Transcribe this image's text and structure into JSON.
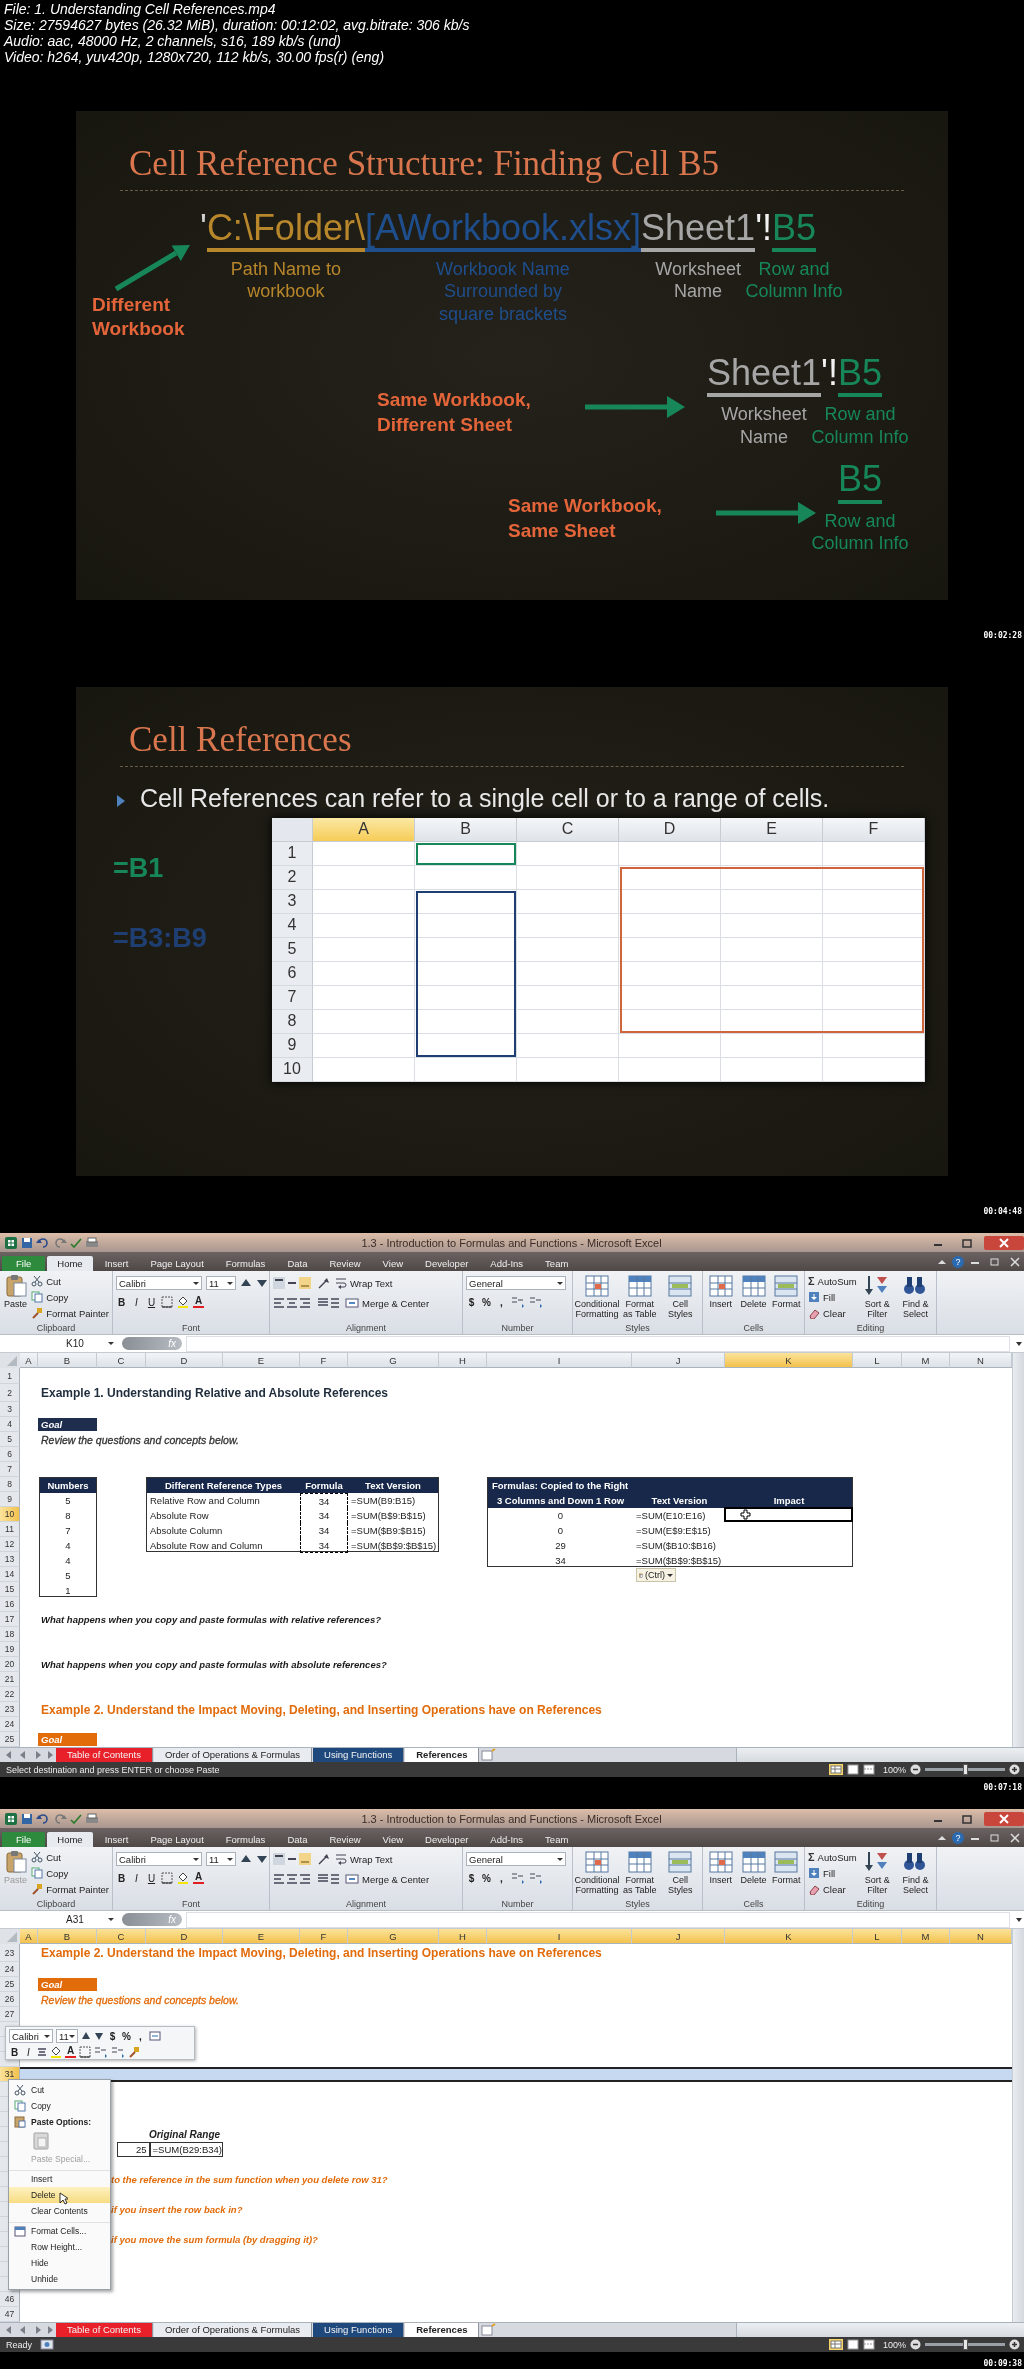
{
  "file_info": [
    "File: 1. Understanding Cell References.mp4",
    "Size: 27594627 bytes (26.32 MiB), duration: 00:12:02, avg.bitrate: 306 kb/s",
    "Audio: aac, 48000 Hz, 2 channels, s16, 189 kb/s (und)",
    "Video: h264, yuv420p, 1280x720, 112 kb/s, 30.00 fps(r) (eng)"
  ],
  "frames": [
    {
      "kind": "reference_slide",
      "timestamp": "00:02:28",
      "title": "Cell Reference Structure: Finding Cell B5",
      "examples": [
        {
          "kind": "full",
          "label": "Different Workbook",
          "segments": [
            {
              "text": "'",
              "color": "#d0d0d0"
            },
            {
              "text": "C:\\Folder\\",
              "color": "#b8862b",
              "caption": "Path Name to\nworkbook"
            },
            {
              "text": "[AWorkbook.xlsx]",
              "color": "#1f4e8c",
              "caption": "Workbook Name\nSurrounded by\nsquare brackets"
            },
            {
              "text": "Sheet1",
              "color": "#a6a6a6",
              "caption": "Worksheet\nName"
            },
            {
              "text": "'!",
              "color": "#f2f2f2"
            },
            {
              "text": "B5",
              "color": "#17875a",
              "caption": "Row and\nColumn Info"
            }
          ]
        },
        {
          "kind": "short",
          "label": "Same Workbook, Different Sheet",
          "segments": [
            {
              "text": "Sheet1",
              "color": "#a6a6a6",
              "caption": "Worksheet\nName"
            },
            {
              "text": "'!",
              "color": "#f2f2f2"
            },
            {
              "text": "B5",
              "color": "#17875a",
              "caption": "Row and\nColumn Info"
            }
          ]
        },
        {
          "kind": "short",
          "label": "Same Workbook, Same Sheet",
          "segments": [
            {
              "text": "B5",
              "color": "#17875a",
              "caption": "Row and\nColumn Info"
            }
          ]
        }
      ]
    },
    {
      "kind": "ranges_slide",
      "timestamp": "00:04:48",
      "title": "Cell References",
      "bullet": "Cell References can refer to a single cell or to a range of cells.",
      "references": [
        {
          "text": "=B1",
          "color": "#17875a"
        },
        {
          "text": "=B3:B9",
          "color": "#1f3f73"
        }
      ],
      "grid": {
        "columns": [
          {
            "label": "A",
            "selected": true
          },
          {
            "label": "B",
            "selected": false
          },
          {
            "label": "C",
            "selected": false
          },
          {
            "label": "D",
            "selected": false
          },
          {
            "label": "E",
            "selected": false
          },
          {
            "label": "F",
            "selected": false
          }
        ],
        "rows": [
          "1",
          "2",
          "3",
          "4",
          "5",
          "6",
          "7",
          "8",
          "9",
          "10"
        ],
        "selections": [
          {
            "color": "#17875a"
          },
          {
            "color": "#1f3f73"
          },
          {
            "color": "#d0643c"
          }
        ]
      }
    },
    {
      "kind": "excel",
      "timestamp": "00:07:18",
      "title": "1.3 - Introduction to Formulas and Functions - Microsoft Excel",
      "help": "?",
      "tabs": [
        {
          "label": "File",
          "kind": "file",
          "selected": false
        },
        {
          "label": "Home",
          "kind": "tab",
          "selected": true
        },
        {
          "label": "Insert",
          "kind": "tab",
          "selected": false
        },
        {
          "label": "Page Layout",
          "kind": "tab",
          "selected": false
        },
        {
          "label": "Formulas",
          "kind": "tab",
          "selected": false
        },
        {
          "label": "Data",
          "kind": "tab",
          "selected": false
        },
        {
          "label": "Review",
          "kind": "tab",
          "selected": false
        },
        {
          "label": "View",
          "kind": "tab",
          "selected": false
        },
        {
          "label": "Developer",
          "kind": "tab",
          "selected": false
        },
        {
          "label": "Add-Ins",
          "kind": "tab",
          "selected": false
        },
        {
          "label": "Team",
          "kind": "tab",
          "selected": false
        }
      ],
      "ribbon": [
        {
          "kind": "clipboard",
          "name": "Clipboard",
          "items": [
            {
              "label": "Paste",
              "disabled": false
            },
            {
              "label": "Cut",
              "disabled": false
            },
            {
              "label": "Copy",
              "disabled": false
            },
            {
              "label": "Format Painter",
              "disabled": false
            }
          ]
        },
        {
          "kind": "font",
          "name": "Font",
          "items": [
            {
              "label": "Calibri"
            },
            {
              "label": "11"
            },
            {
              "label": "B"
            },
            {
              "label": "I"
            },
            {
              "label": "U"
            },
            {
              "label": "A"
            }
          ]
        },
        {
          "kind": "alignment",
          "name": "Alignment",
          "items": [
            {
              "label": "Wrap Text"
            },
            {
              "label": "Merge & Center"
            }
          ]
        },
        {
          "kind": "number",
          "name": "Number",
          "items": [
            {
              "label": "General"
            },
            {
              "label": "$"
            },
            {
              "label": "%"
            },
            {
              "label": ","
            }
          ]
        },
        {
          "kind": "large",
          "name": "Styles",
          "items": [
            {
              "label": "Conditional Formatting"
            },
            {
              "label": "Format as Table"
            },
            {
              "label": "Cell Styles"
            }
          ]
        },
        {
          "kind": "large",
          "name": "Cells",
          "items": [
            {
              "label": "Insert"
            },
            {
              "label": "Delete"
            },
            {
              "label": "Format"
            }
          ]
        },
        {
          "kind": "editing",
          "name": "Editing",
          "items": [
            {
              "label": "AutoSum",
              "glyph": "Σ"
            },
            {
              "label": "Fill"
            },
            {
              "label": "Clear"
            },
            {
              "label": "Sort & Filter"
            },
            {
              "label": "Find & Select"
            }
          ]
        }
      ],
      "formula_bar": {
        "name_box": "K10",
        "fx": "fx"
      },
      "sheet": {
        "selection": {
          "kind": "cell"
        },
        "columns": [
          {
            "label": "A",
            "selected": false
          },
          {
            "label": "B",
            "selected": false
          },
          {
            "label": "C",
            "selected": false
          },
          {
            "label": "D",
            "selected": false
          },
          {
            "label": "E",
            "selected": false
          },
          {
            "label": "F",
            "selected": false
          },
          {
            "label": "G",
            "selected": false
          },
          {
            "label": "H",
            "selected": false
          },
          {
            "label": "I",
            "selected": false
          },
          {
            "label": "J",
            "selected": false
          },
          {
            "label": "K",
            "selected": true
          },
          {
            "label": "L",
            "selected": false
          },
          {
            "label": "M",
            "selected": false
          },
          {
            "label": "N",
            "selected": false
          }
        ],
        "rows": [
          {
            "number": "1",
            "selected": false
          },
          {
            "number": "2",
            "selected": false
          },
          {
            "number": "3",
            "selected": false
          },
          {
            "number": "4",
            "selected": false
          },
          {
            "number": "5",
            "selected": false
          },
          {
            "number": "6",
            "selected": false
          },
          {
            "number": "7",
            "selected": false
          },
          {
            "number": "8",
            "selected": false
          },
          {
            "number": "9",
            "selected": false
          },
          {
            "number": "10",
            "selected": true
          },
          {
            "number": "11",
            "selected": false
          },
          {
            "number": "12",
            "selected": false
          },
          {
            "number": "13",
            "selected": false
          },
          {
            "number": "14",
            "selected": false
          },
          {
            "number": "15",
            "selected": false
          },
          {
            "number": "16",
            "selected": false
          },
          {
            "number": "17",
            "selected": false
          },
          {
            "number": "18",
            "selected": false
          },
          {
            "number": "19",
            "selected": false
          },
          {
            "number": "20",
            "selected": false
          },
          {
            "number": "21",
            "selected": false
          },
          {
            "number": "22",
            "selected": false
          },
          {
            "number": "23",
            "selected": false
          },
          {
            "number": "24",
            "selected": false
          },
          {
            "number": "25",
            "selected": false
          }
        ],
        "blocks": [
          {
            "kind": "heading",
            "text": "Example 1. Understanding Relative and Absolute References",
            "color": "#1f2d3d"
          },
          {
            "kind": "goal",
            "text": "Goal",
            "color": "#1f2d4f"
          },
          {
            "kind": "note",
            "text": "Review the questions and concepts below.",
            "color": "#333333"
          },
          {
            "kind": "numbers_table",
            "header": "Numbers",
            "values": [
              "5",
              "8",
              "7",
              "4",
              "4",
              "5",
              "1"
            ]
          },
          {
            "kind": "reference_table",
            "copied": true,
            "columns": [
              "Different Reference Types",
              "Formula",
              "Text Version"
            ],
            "rows": [
              [
                "Relative Row and Column",
                "34",
                "=SUM(B9:B15)"
              ],
              [
                "Absolute Row",
                "34",
                "=SUM(B$9:B$15)"
              ],
              [
                "Absolute Column",
                "34",
                "=SUM($B9:$B15)"
              ],
              [
                "Absolute Row and Column",
                "34",
                "=SUM($B$9:$B$15)"
              ]
            ]
          },
          {
            "kind": "copied_table",
            "title": "Formulas: Copied to the Right",
            "columns": [
              "3 Columns and Down 1 Row",
              "Text Version",
              "Impact"
            ],
            "rows": [
              [
                "0",
                "=SUM(E10:E16)"
              ],
              [
                "0",
                "=SUM(E$9:E$15)"
              ],
              [
                "29",
                "=SUM($B10:$B16)"
              ],
              [
                "34",
                "=SUM($B$9:$B$15)"
              ]
            ]
          },
          {
            "kind": "paste_button",
            "text": "(Ctrl)"
          },
          {
            "kind": "question",
            "text": "What happens when you copy and paste formulas with relative references?",
            "color": "#1a1a1a"
          },
          {
            "kind": "question",
            "text": "What happens when you copy and paste formulas with absolute references?",
            "color": "#1a1a1a"
          },
          {
            "kind": "heading",
            "text": "Example 2. Understand the Impact Moving, Deleting, and Inserting Operations have on References",
            "color": "#e26b0a"
          },
          {
            "kind": "goal",
            "text": "Goal",
            "color": "#e26b0a"
          }
        ]
      },
      "sheet_tabs": [
        {
          "label": "Table of Contents",
          "color": "#e8202a",
          "selected": false
        },
        {
          "label": "Order of Operations & Formulas",
          "selected": false
        },
        {
          "label": "Using Functions",
          "color": "#1f497d",
          "selected": false
        },
        {
          "label": "References",
          "selected": true
        }
      ],
      "status": {
        "text": "Select destination and press ENTER or choose Paste",
        "zoom": "100%",
        "zoom_slider": {
          "level": 0.5
        }
      }
    },
    {
      "kind": "excel",
      "timestamp": "00:09:38",
      "title": "1.3 - Introduction to Formulas and Functions - Microsoft Excel",
      "help": "?",
      "tabs": [
        {
          "label": "File",
          "kind": "file",
          "selected": false
        },
        {
          "label": "Home",
          "kind": "tab",
          "selected": true
        },
        {
          "label": "Insert",
          "kind": "tab",
          "selected": false
        },
        {
          "label": "Page Layout",
          "kind": "tab",
          "selected": false
        },
        {
          "label": "Formulas",
          "kind": "tab",
          "selected": false
        },
        {
          "label": "Data",
          "kind": "tab",
          "selected": false
        },
        {
          "label": "Review",
          "kind": "tab",
          "selected": false
        },
        {
          "label": "View",
          "kind": "tab",
          "selected": false
        },
        {
          "label": "Developer",
          "kind": "tab",
          "selected": false
        },
        {
          "label": "Add-Ins",
          "kind": "tab",
          "selected": false
        },
        {
          "label": "Team",
          "kind": "tab",
          "selected": false
        }
      ],
      "ribbon": [
        {
          "kind": "clipboard",
          "name": "Clipboard",
          "items": [
            {
              "label": "Paste",
              "disabled": true
            },
            {
              "label": "Cut",
              "disabled": false
            },
            {
              "label": "Copy",
              "disabled": false
            },
            {
              "label": "Format Painter",
              "disabled": false
            }
          ]
        },
        {
          "kind": "font",
          "name": "Font",
          "items": [
            {
              "label": "Calibri"
            },
            {
              "label": "11"
            },
            {
              "label": "B"
            },
            {
              "label": "I"
            },
            {
              "label": "U"
            },
            {
              "label": "A"
            }
          ]
        },
        {
          "kind": "alignment",
          "name": "Alignment",
          "items": [
            {
              "label": "Wrap Text"
            },
            {
              "label": "Merge & Center"
            }
          ]
        },
        {
          "kind": "number",
          "name": "Number",
          "items": [
            {
              "label": "General"
            },
            {
              "label": "$"
            },
            {
              "label": "%"
            },
            {
              "label": ","
            }
          ]
        },
        {
          "kind": "large",
          "name": "Styles",
          "items": [
            {
              "label": "Conditional Formatting"
            },
            {
              "label": "Format as Table"
            },
            {
              "label": "Cell Styles"
            }
          ]
        },
        {
          "kind": "large",
          "name": "Cells",
          "items": [
            {
              "label": "Insert"
            },
            {
              "label": "Delete"
            },
            {
              "label": "Format"
            }
          ]
        },
        {
          "kind": "editing",
          "name": "Editing",
          "items": [
            {
              "label": "AutoSum",
              "glyph": "Σ"
            },
            {
              "label": "Fill"
            },
            {
              "label": "Clear"
            },
            {
              "label": "Sort & Filter"
            },
            {
              "label": "Find & Select"
            }
          ]
        }
      ],
      "formula_bar": {
        "name_box": "A31",
        "fx": "fx"
      },
      "sheet": {
        "selection": {
          "kind": "row"
        },
        "columns": [
          {
            "label": "A",
            "selected": true
          },
          {
            "label": "B",
            "selected": true
          },
          {
            "label": "C",
            "selected": true
          },
          {
            "label": "D",
            "selected": true
          },
          {
            "label": "E",
            "selected": true
          },
          {
            "label": "F",
            "selected": true
          },
          {
            "label": "G",
            "selected": true
          },
          {
            "label": "H",
            "selected": true
          },
          {
            "label": "I",
            "selected": true
          },
          {
            "label": "J",
            "selected": true
          },
          {
            "label": "K",
            "selected": true
          },
          {
            "label": "L",
            "selected": true
          },
          {
            "label": "M",
            "selected": true
          },
          {
            "label": "N",
            "selected": true
          }
        ],
        "rows": [
          {
            "number": "23",
            "selected": false
          },
          {
            "number": "24",
            "selected": false
          },
          {
            "number": "25",
            "selected": false
          },
          {
            "number": "26",
            "selected": false
          },
          {
            "number": "27",
            "selected": false
          },
          {
            "selected": false
          },
          {
            "selected": false
          },
          {
            "selected": false
          },
          {
            "number": "31",
            "selected": true
          },
          {
            "selected": false
          },
          {
            "selected": false
          },
          {
            "selected": false
          },
          {
            "selected": false
          },
          {
            "selected": false
          },
          {
            "selected": false
          },
          {
            "selected": false
          },
          {
            "selected": false
          },
          {
            "selected": false
          },
          {
            "selected": false
          },
          {
            "selected": false
          },
          {
            "selected": false
          },
          {
            "selected": false
          },
          {
            "selected": false
          },
          {
            "number": "46",
            "selected": false
          },
          {
            "number": "47",
            "selected": false
          }
        ],
        "blocks": [
          {
            "kind": "heading",
            "text": "Example 2. Understand the Impact Moving, Deleting, and Inserting Operations have on References",
            "color": "#e26b0a"
          },
          {
            "kind": "goal",
            "text": "Goal",
            "color": "#e26b0a"
          },
          {
            "kind": "note",
            "text": "Review the questions and concepts below.",
            "color": "#e26b0a"
          },
          {
            "kind": "label",
            "text": "Original Range"
          },
          {
            "kind": "range_row",
            "values": [
              "25",
              "=SUM(B29:B34)"
            ]
          },
          {
            "kind": "question",
            "text": "to the reference in the sum function when you delete row 31?",
            "color": "#e26b0a"
          },
          {
            "kind": "question",
            "text": "if you insert the row back in?",
            "color": "#e26b0a"
          },
          {
            "kind": "question",
            "text": "if you move the sum formula (by dragging it)?",
            "color": "#e26b0a"
          }
        ]
      },
      "mini_toolbar": {
        "font": "Calibri",
        "size": "11",
        "row1_glyphs": [
          "$",
          "%",
          ","
        ],
        "row2_glyphs": [
          "B",
          "I",
          "A"
        ]
      },
      "context_menu": [
        {
          "kind": "item",
          "label": "Cut",
          "selected": false,
          "disabled": false
        },
        {
          "kind": "item",
          "label": "Copy",
          "selected": false,
          "disabled": false
        },
        {
          "kind": "header",
          "label": "Paste Options:"
        },
        {
          "kind": "paste_icons"
        },
        {
          "kind": "item",
          "label": "Paste Special...",
          "selected": false,
          "disabled": true
        },
        {
          "kind": "item",
          "label": "Insert",
          "selected": false,
          "disabled": false
        },
        {
          "kind": "item",
          "label": "Delete",
          "selected": true,
          "disabled": false
        },
        {
          "kind": "item",
          "label": "Clear Contents",
          "selected": false,
          "disabled": false
        },
        {
          "kind": "item",
          "label": "Format Cells...",
          "selected": false,
          "disabled": false
        },
        {
          "kind": "item",
          "label": "Row Height...",
          "selected": false,
          "disabled": false
        },
        {
          "kind": "item",
          "label": "Hide",
          "selected": false,
          "disabled": false
        },
        {
          "kind": "item",
          "label": "Unhide",
          "selected": false,
          "disabled": false
        }
      ],
      "sheet_tabs": [
        {
          "label": "Table of Contents",
          "color": "#e8202a",
          "selected": false
        },
        {
          "label": "Order of Operations & Formulas",
          "selected": false
        },
        {
          "label": "Using Functions",
          "color": "#1f497d",
          "selected": false
        },
        {
          "label": "References",
          "selected": true
        }
      ],
      "status": {
        "text": "Ready",
        "macro_record": true,
        "zoom": "100%",
        "zoom_slider": {
          "level": 0.5
        }
      }
    }
  ]
}
